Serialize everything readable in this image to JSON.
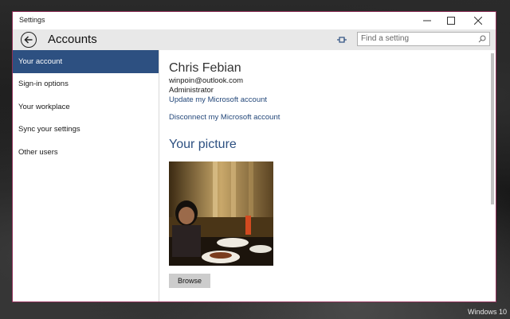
{
  "window": {
    "title": "Settings",
    "minimize_glyph": "─",
    "maximize_glyph": "☐",
    "close_glyph": "✕"
  },
  "header": {
    "page_title": "Accounts",
    "back_icon": "back-arrow-icon",
    "pin_icon": "pin-icon",
    "search": {
      "placeholder": "Find a setting",
      "value": ""
    }
  },
  "sidebar": {
    "items": [
      {
        "label": "Your account",
        "active": true
      },
      {
        "label": "Sign-in options",
        "active": false
      },
      {
        "label": "Your workplace",
        "active": false
      },
      {
        "label": "Sync your settings",
        "active": false
      },
      {
        "label": "Other users",
        "active": false
      }
    ]
  },
  "account": {
    "name": "Chris Febian",
    "email": "winpoin@outlook.com",
    "role": "Administrator",
    "update_link": "Update my Microsoft account",
    "disconnect_link": "Disconnect my Microsoft account"
  },
  "picture_section": {
    "title": "Your picture",
    "browse_label": "Browse"
  },
  "desktop": {
    "watermark": "Windows 10"
  },
  "colors": {
    "accent": "#2d5081",
    "link": "#24487a",
    "header_bg": "#e8e8e8",
    "window_border": "#8f2f58"
  }
}
